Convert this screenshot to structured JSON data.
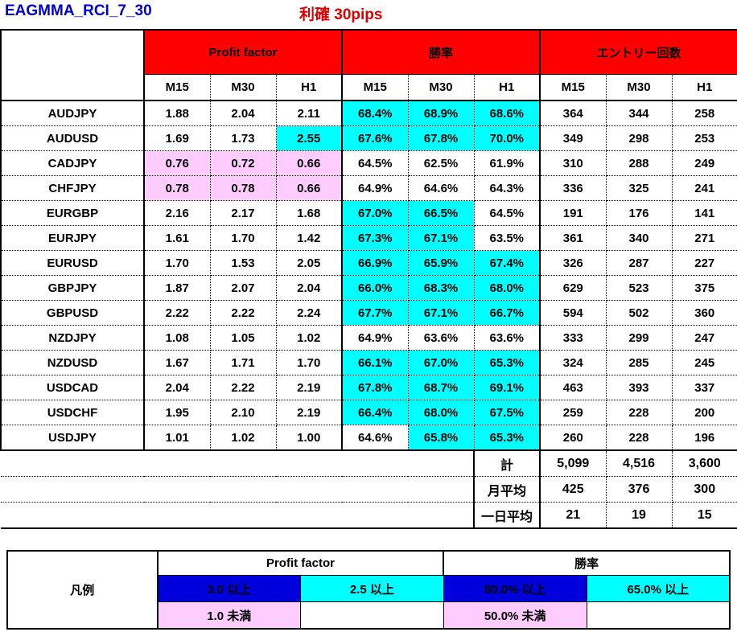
{
  "title": {
    "left": "EAGMMA_RCI_7_30",
    "center": "利確 30pips"
  },
  "table": {
    "groups": [
      {
        "label": "Profit factor"
      },
      {
        "label": "勝率"
      },
      {
        "label": "エントリー回数"
      }
    ],
    "timeframes": [
      "M15",
      "M30",
      "H1"
    ],
    "rows": [
      {
        "pair": "AUDJPY",
        "pf": [
          "1.88",
          "2.04",
          "2.11"
        ],
        "pf_hl": [
          "none",
          "none",
          "none"
        ],
        "wr": [
          "68.4%",
          "68.9%",
          "68.6%"
        ],
        "wr_hl": [
          "cyan",
          "cyan",
          "cyan"
        ],
        "entries": [
          "364",
          "344",
          "258"
        ]
      },
      {
        "pair": "AUDUSD",
        "pf": [
          "1.69",
          "1.73",
          "2.55"
        ],
        "pf_hl": [
          "none",
          "none",
          "cyan"
        ],
        "wr": [
          "67.6%",
          "67.8%",
          "70.0%"
        ],
        "wr_hl": [
          "cyan",
          "cyan",
          "cyan"
        ],
        "entries": [
          "349",
          "298",
          "253"
        ]
      },
      {
        "pair": "CADJPY",
        "pf": [
          "0.76",
          "0.72",
          "0.66"
        ],
        "pf_hl": [
          "pink",
          "pink",
          "pink"
        ],
        "wr": [
          "64.5%",
          "62.5%",
          "61.9%"
        ],
        "wr_hl": [
          "none",
          "none",
          "none"
        ],
        "entries": [
          "310",
          "288",
          "249"
        ]
      },
      {
        "pair": "CHFJPY",
        "pf": [
          "0.78",
          "0.78",
          "0.66"
        ],
        "pf_hl": [
          "pink",
          "pink",
          "pink"
        ],
        "wr": [
          "64.9%",
          "64.6%",
          "64.3%"
        ],
        "wr_hl": [
          "none",
          "none",
          "none"
        ],
        "entries": [
          "336",
          "325",
          "241"
        ]
      },
      {
        "pair": "EURGBP",
        "pf": [
          "2.16",
          "2.17",
          "1.68"
        ],
        "pf_hl": [
          "none",
          "none",
          "none"
        ],
        "wr": [
          "67.0%",
          "66.5%",
          "64.5%"
        ],
        "wr_hl": [
          "cyan",
          "cyan",
          "none"
        ],
        "entries": [
          "191",
          "176",
          "141"
        ]
      },
      {
        "pair": "EURJPY",
        "pf": [
          "1.61",
          "1.70",
          "1.42"
        ],
        "pf_hl": [
          "none",
          "none",
          "none"
        ],
        "wr": [
          "67.3%",
          "67.1%",
          "63.5%"
        ],
        "wr_hl": [
          "cyan",
          "cyan",
          "none"
        ],
        "entries": [
          "361",
          "340",
          "271"
        ]
      },
      {
        "pair": "EURUSD",
        "pf": [
          "1.70",
          "1.53",
          "2.05"
        ],
        "pf_hl": [
          "none",
          "none",
          "none"
        ],
        "wr": [
          "66.9%",
          "65.9%",
          "67.4%"
        ],
        "wr_hl": [
          "cyan",
          "cyan",
          "cyan"
        ],
        "entries": [
          "326",
          "287",
          "227"
        ]
      },
      {
        "pair": "GBPJPY",
        "pf": [
          "1.87",
          "2.07",
          "2.04"
        ],
        "pf_hl": [
          "none",
          "none",
          "none"
        ],
        "wr": [
          "66.0%",
          "68.3%",
          "68.0%"
        ],
        "wr_hl": [
          "cyan",
          "cyan",
          "cyan"
        ],
        "entries": [
          "629",
          "523",
          "375"
        ]
      },
      {
        "pair": "GBPUSD",
        "pf": [
          "2.22",
          "2.22",
          "2.24"
        ],
        "pf_hl": [
          "none",
          "none",
          "none"
        ],
        "wr": [
          "67.7%",
          "67.1%",
          "66.7%"
        ],
        "wr_hl": [
          "cyan",
          "cyan",
          "cyan"
        ],
        "entries": [
          "594",
          "502",
          "360"
        ]
      },
      {
        "pair": "NZDJPY",
        "pf": [
          "1.08",
          "1.05",
          "1.02"
        ],
        "pf_hl": [
          "none",
          "none",
          "none"
        ],
        "wr": [
          "64.9%",
          "63.6%",
          "63.6%"
        ],
        "wr_hl": [
          "none",
          "none",
          "none"
        ],
        "entries": [
          "333",
          "299",
          "247"
        ]
      },
      {
        "pair": "NZDUSD",
        "pf": [
          "1.67",
          "1.71",
          "1.70"
        ],
        "pf_hl": [
          "none",
          "none",
          "none"
        ],
        "wr": [
          "66.1%",
          "67.0%",
          "65.3%"
        ],
        "wr_hl": [
          "cyan",
          "cyan",
          "cyan"
        ],
        "entries": [
          "324",
          "285",
          "245"
        ]
      },
      {
        "pair": "USDCAD",
        "pf": [
          "2.04",
          "2.22",
          "2.19"
        ],
        "pf_hl": [
          "none",
          "none",
          "none"
        ],
        "wr": [
          "67.8%",
          "68.7%",
          "69.1%"
        ],
        "wr_hl": [
          "cyan",
          "cyan",
          "cyan"
        ],
        "entries": [
          "463",
          "393",
          "337"
        ]
      },
      {
        "pair": "USDCHF",
        "pf": [
          "1.95",
          "2.10",
          "2.19"
        ],
        "pf_hl": [
          "none",
          "none",
          "none"
        ],
        "wr": [
          "66.4%",
          "68.0%",
          "67.5%"
        ],
        "wr_hl": [
          "cyan",
          "cyan",
          "cyan"
        ],
        "entries": [
          "259",
          "228",
          "200"
        ]
      },
      {
        "pair": "USDJPY",
        "pf": [
          "1.01",
          "1.02",
          "1.00"
        ],
        "pf_hl": [
          "none",
          "none",
          "none"
        ],
        "wr": [
          "64.6%",
          "65.8%",
          "65.3%"
        ],
        "wr_hl": [
          "none",
          "cyan",
          "cyan"
        ],
        "entries": [
          "260",
          "228",
          "196"
        ]
      }
    ],
    "summary": [
      {
        "label": "計",
        "values": [
          "5,099",
          "4,516",
          "3,600"
        ]
      },
      {
        "label": "月平均",
        "values": [
          "425",
          "376",
          "300"
        ]
      },
      {
        "label": "一日平均",
        "values": [
          "21",
          "19",
          "15"
        ]
      }
    ]
  },
  "legend": {
    "title": "凡例",
    "headers": [
      "Profit factor",
      "勝率"
    ],
    "cells": [
      {
        "text": "3.0 以上",
        "style": "blue"
      },
      {
        "text": "2.5 以上",
        "style": "cyan"
      },
      {
        "text": "80.0% 以上",
        "style": "blue"
      },
      {
        "text": "65.0% 以上",
        "style": "cyan"
      },
      {
        "text": "1.0 未満",
        "style": "pink"
      },
      {
        "text": "",
        "style": "white"
      },
      {
        "text": "50.0% 未満",
        "style": "pink"
      },
      {
        "text": "",
        "style": "white"
      }
    ]
  },
  "colors": {
    "header_red": "#ff0000",
    "highlight_cyan": "#00ffff",
    "highlight_pink": "#ffccff",
    "highlight_blue": "#0000dd",
    "title_blue": "#0000cc",
    "title_red": "#dd0000"
  }
}
